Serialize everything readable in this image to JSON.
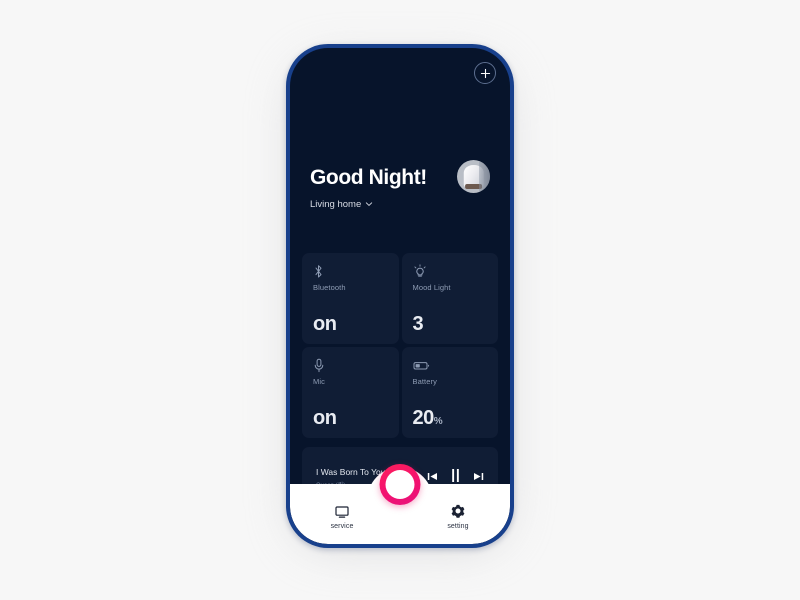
{
  "app": {
    "theme": {
      "frame_color": "#18408c",
      "screen_bg": "#07142b",
      "tile_bg": "#101d35",
      "accent_pink": "#f4136e",
      "nav_bg": "#ffffff",
      "page_bg": "#f7f7f7"
    }
  },
  "topbar": {
    "add_button": "add-icon"
  },
  "header": {
    "greeting": "Good Night!",
    "room": "Living home",
    "chevron": "chevron-down-icon",
    "avatar": "smart-speaker-photo"
  },
  "tiles": [
    {
      "icon": "bluetooth-icon",
      "label": "Bluetooth",
      "value": "on",
      "unit": ""
    },
    {
      "icon": "bulb-icon",
      "label": "Mood Light",
      "value": "3",
      "unit": ""
    },
    {
      "icon": "mic-icon",
      "label": "Mic",
      "value": "on",
      "unit": ""
    },
    {
      "icon": "battery-icon",
      "label": "Battery",
      "value": "20",
      "unit": "%"
    }
  ],
  "player": {
    "title": "I Was Born To You Love",
    "artist": "Queen (퀸)",
    "controls": {
      "previous": "previous-track-icon",
      "playpause": "pause-icon",
      "next": "next-track-icon"
    }
  },
  "bottom_nav": {
    "items": [
      {
        "icon": "monitor-icon",
        "label": "service"
      },
      {
        "icon": "gear-icon",
        "label": "setting"
      }
    ],
    "center_button": "record-button"
  }
}
